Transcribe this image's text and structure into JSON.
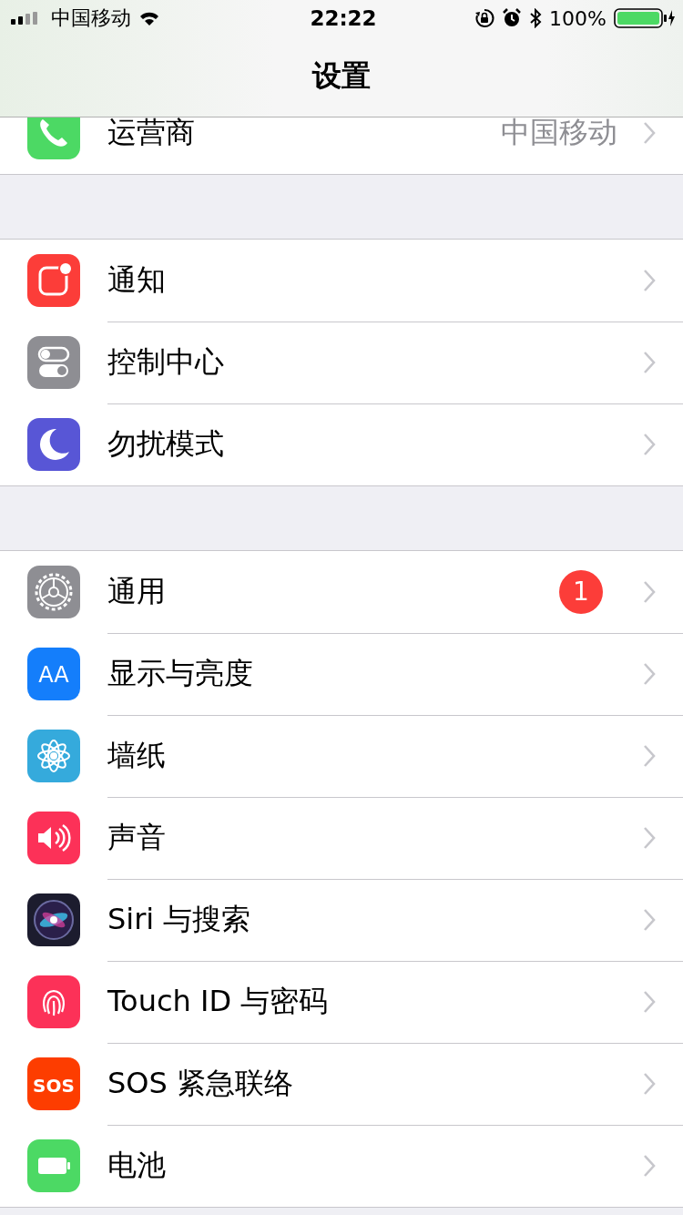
{
  "status_bar": {
    "carrier": "中国移动",
    "time": "22:22",
    "battery": "100%"
  },
  "nav": {
    "title": "设置"
  },
  "groups": [
    {
      "kind": "partial",
      "rows": [
        {
          "kind": "phone",
          "label": "运营商",
          "value": "中国移动"
        }
      ]
    },
    {
      "kind": "full",
      "rows": [
        {
          "kind": "notifications",
          "label": "通知"
        },
        {
          "kind": "toggles",
          "label": "控制中心"
        },
        {
          "kind": "moon",
          "label": "勿扰模式"
        }
      ]
    },
    {
      "kind": "full",
      "rows": [
        {
          "kind": "gear",
          "label": "通用",
          "badge": "1"
        },
        {
          "kind": "text-size",
          "label": "显示与亮度",
          "icon_text": "AA"
        },
        {
          "kind": "flower",
          "label": "墙纸"
        },
        {
          "kind": "speaker",
          "label": "声音"
        },
        {
          "kind": "orb",
          "label": "Siri 与搜索"
        },
        {
          "kind": "fingerprint",
          "label": "Touch ID 与密码"
        },
        {
          "kind": "sos",
          "label": "SOS 紧急联络",
          "icon_text": "SOS"
        },
        {
          "kind": "battery",
          "label": "电池"
        }
      ]
    }
  ]
}
